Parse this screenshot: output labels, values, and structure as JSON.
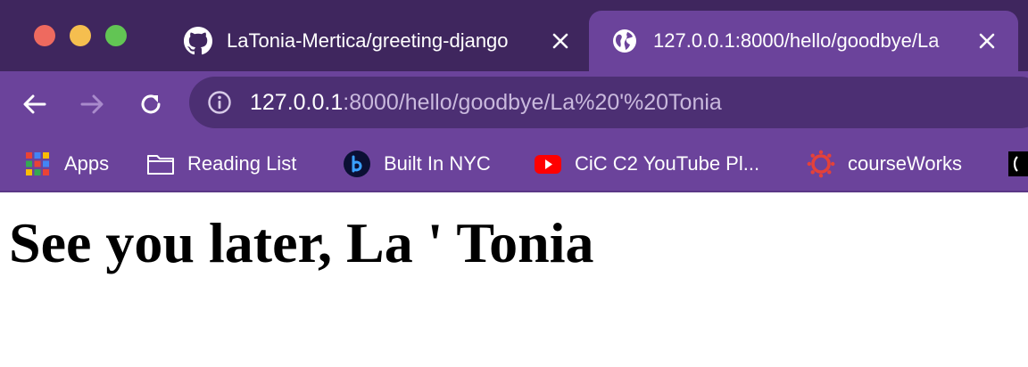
{
  "window": {
    "traffic_lights": [
      "close",
      "minimize",
      "zoom"
    ]
  },
  "tabs": [
    {
      "title": "LaTonia-Mertica/greeting-django",
      "icon": "github-icon",
      "active": false
    },
    {
      "title": "127.0.0.1:8000/hello/goodbye/La",
      "icon": "globe-icon",
      "active": true
    }
  ],
  "toolbar": {
    "url_host": "127.0.0.1",
    "url_rest": ":8000/hello/goodbye/La%20'%20Tonia"
  },
  "bookmarks": [
    {
      "label": "Apps",
      "icon": "apps-grid-icon"
    },
    {
      "label": "Reading List",
      "icon": "folder-icon"
    },
    {
      "label": "Built In NYC",
      "icon": "builtin-logo-icon"
    },
    {
      "label": "CiC C2 YouTube Pl...",
      "icon": "youtube-icon"
    },
    {
      "label": "courseWorks",
      "icon": "canvas-logo-icon"
    },
    {
      "label": "",
      "icon": "extra-bookmark-icon"
    }
  ],
  "page": {
    "heading": "See you later, La ' Tonia"
  },
  "colors": {
    "tabstrip": "#3f265e",
    "toolbar": "#6b439b",
    "omnibox": "#4c2f73"
  }
}
